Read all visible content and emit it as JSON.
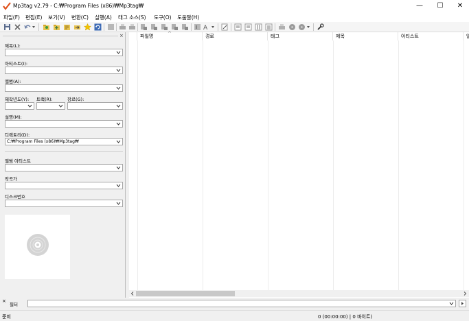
{
  "window": {
    "title": "Mp3tag v2.79  -  C:₩Program Files (x86)₩Mp3tag₩",
    "minimize_glyph": "—",
    "maximize_glyph": "☐",
    "close_glyph": "✕"
  },
  "menu": [
    {
      "label": "파일(F)"
    },
    {
      "label": "편집(E)"
    },
    {
      "label": "보기(V)"
    },
    {
      "label": "변환(C)"
    },
    {
      "label": "실행(A)"
    },
    {
      "label": "태그 소스(S)"
    },
    {
      "label": "도구(O)"
    },
    {
      "label": "도움말(H)"
    }
  ],
  "toolbar": {
    "icons": [
      "save-icon",
      "remove-tag-icon",
      "undo-icon",
      "change-directory-icon",
      "add-directory-icon",
      "open-playlist-icon",
      "export-icon",
      "favorites-star-icon",
      "refresh-icon"
    ]
  },
  "panel": {
    "close_glyph": "×",
    "title_label": "제목(L):",
    "title_value": "",
    "artist_label": "아티스트(I):",
    "artist_value": "",
    "album_label": "앨범(A):",
    "album_value": "",
    "year_label": "제작년도(Y):",
    "year_value": "",
    "track_label": "트랙(R):",
    "track_value": "",
    "genre_label": "장르(G):",
    "genre_value": "",
    "comment_label": "설명(M):",
    "comment_value": "",
    "directory_label": "디렉토리(D):",
    "directory_value": "C:₩Program Files (x86)₩Mp3tag₩",
    "album_artist_label": "앨범 아티스트",
    "album_artist_value": "",
    "composer_label": "작곡가",
    "composer_value": "",
    "disc_label": "디스크번호",
    "disc_value": ""
  },
  "filelist": {
    "sort_glyph": "^",
    "columns": [
      "파일명",
      "경로",
      "태그",
      "제목",
      "아티스트",
      "앨"
    ]
  },
  "filter": {
    "close_glyph": "×",
    "label": "필터",
    "value": ""
  },
  "status": {
    "left": "준비",
    "right": "0 (00:00:00) | 0 바이트)"
  },
  "colors": {
    "accent_logo": "#e0521c",
    "panel_bg": "#f0f0f0",
    "list_bg": "#ffffff",
    "border": "#a6a6a6"
  }
}
